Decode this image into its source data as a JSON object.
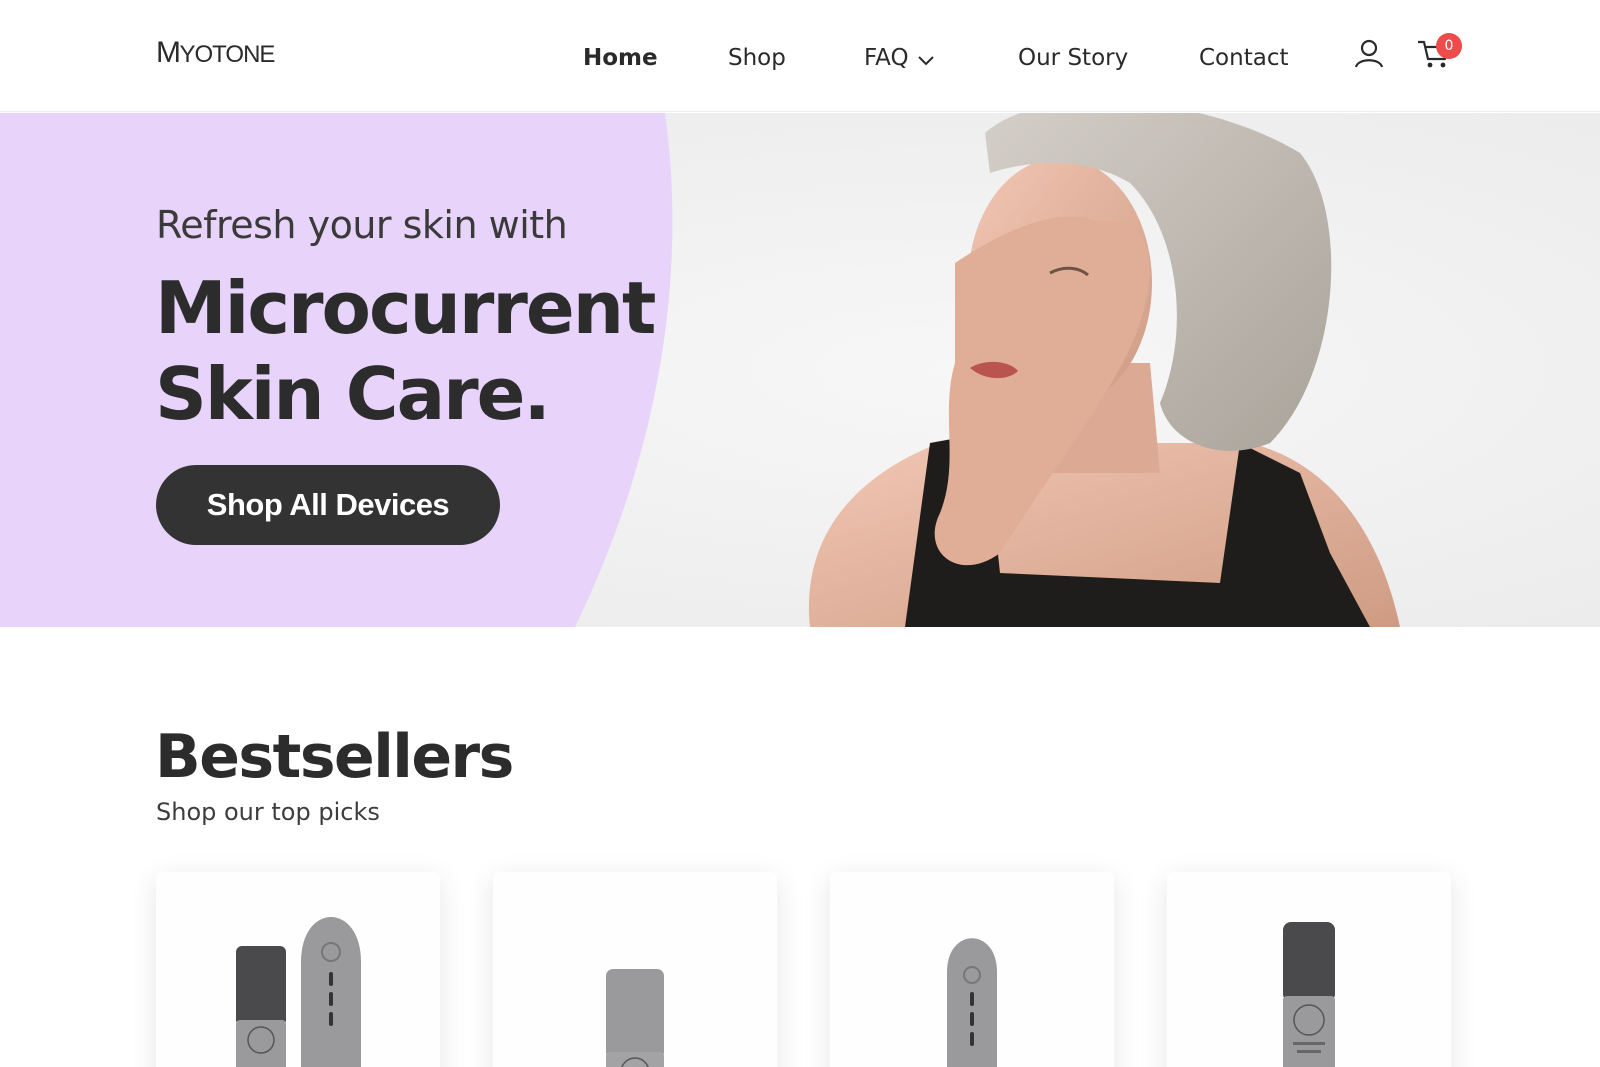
{
  "brand": {
    "logo_first": "M",
    "logo_rest": "YOTONE"
  },
  "nav": {
    "home": "Home",
    "shop": "Shop",
    "faq": "FAQ",
    "our_story": "Our Story",
    "contact": "Contact"
  },
  "header_icons": {
    "account": "user-icon",
    "cart": "cart-icon",
    "cart_count": "0"
  },
  "hero": {
    "subtitle": "Refresh your skin with",
    "title_line1": "Microcurrent",
    "title_line2": "Skin Care.",
    "cta_label": "Shop All Devices",
    "panel_color": "#e8d4fb"
  },
  "bestsellers": {
    "title": "Bestsellers",
    "subtitle": "Shop our top picks",
    "products": [
      {
        "image": "device-and-serum-bundle"
      },
      {
        "image": "serum-bottle-small"
      },
      {
        "image": "microcurrent-wand"
      },
      {
        "image": "serum-bottle-large"
      }
    ]
  },
  "colors": {
    "text_dark": "#2c2c2c",
    "button_dark": "#333333",
    "badge_red": "#ee4b4b",
    "hero_lavender": "#e8d4fb"
  }
}
